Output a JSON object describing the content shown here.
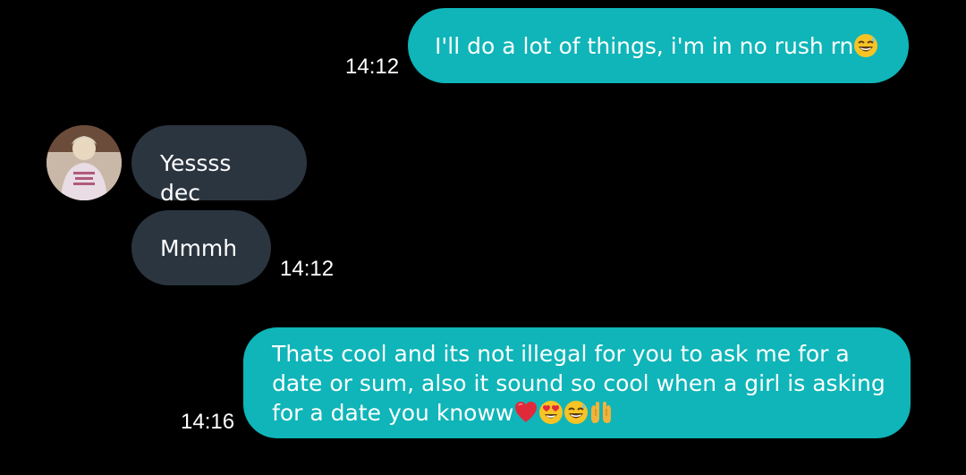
{
  "messages": [
    {
      "direction": "sent",
      "text": "I'll do a lot of things, i'm in no rush rn",
      "emojis": [
        "grinning-sweat-emoji"
      ],
      "time": "14:12"
    },
    {
      "direction": "received",
      "text": "Yessss dec"
    },
    {
      "direction": "received",
      "text": "Mmmh",
      "time": "14:12"
    },
    {
      "direction": "sent",
      "lines": [
        "Thats cool and its not illegal for you to ask me for a",
        "date or sum, also it sound so cool when a girl is asking",
        "for a date you knoww"
      ],
      "emojis": [
        "red-heart-emoji",
        "heart-eyes-emoji",
        "grinning-sweat-emoji",
        "palms-up-emoji"
      ],
      "time": "14:16"
    }
  ],
  "contact": {
    "avatar_icon": "contact-avatar"
  },
  "colors": {
    "background": "#000000",
    "sent_bubble": "#0fb5b8",
    "received_bubble": "#2b3540",
    "text": "#ffffff"
  }
}
